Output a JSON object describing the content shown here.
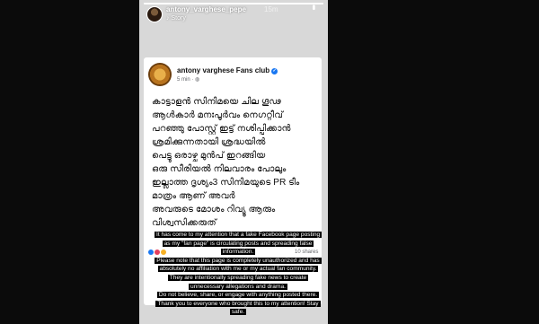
{
  "story": {
    "username": "antony_varghese_pepe",
    "time": "15m",
    "subtitle": "Story",
    "progress": 1.0
  },
  "post": {
    "page_name": "antony varghese Fans club",
    "time": "5 min",
    "body": "കാട്ടാളൻ സിനിമയെ ചില ഗൂഢ\nആൾകാർ മനഃപൂർവം നെഗറ്റീവ്\nപറഞ്ഞു പോസ്റ്റ്‌ ഇട്ട് നശിപ്പിക്കാൻ\nശ്രമിക്കുന്നതായി ശ്രദ്ധയിൽ\nപെട്ടു  ഒരാഴ്ച മുൻപ് ഇറങ്ങിയ\nഒരു സീരിയൽ നിലവാരം പോലും\nഇല്ലാത്ത ദൃശ്യം3  സിനിമയുടെ PR ടീം\nമാത്രം ആണ് അവർ\nഅവരുടെ മോശം റിവ്യൂ ആരും\nവിശ്വസിക്കരുത്",
    "shares": "10 shares"
  },
  "overlay": {
    "text1": "It has come to my attention that a fake Facebook page posting as my \"fan page\" is circulating posts and spreading false information.",
    "text2": "Please note that this page is completely unauthorized and has absolutely no affiliation with me or my actual fan community. They are intentionally spreading fake news to create unnecessary allegations and drama.",
    "text3": "Do not believe, share, or engage with anything posted there. Thank you to everyone who brought this to my attention! Stay safe."
  },
  "icons": {
    "verified": "verified-badge-icon",
    "more": "more-options-icon",
    "music": "music-note-icon",
    "globe": "globe-icon"
  },
  "colors": {
    "verified": "#1877f2",
    "story_bg": "#d8d8d8",
    "overlay_bg": "#000000"
  }
}
